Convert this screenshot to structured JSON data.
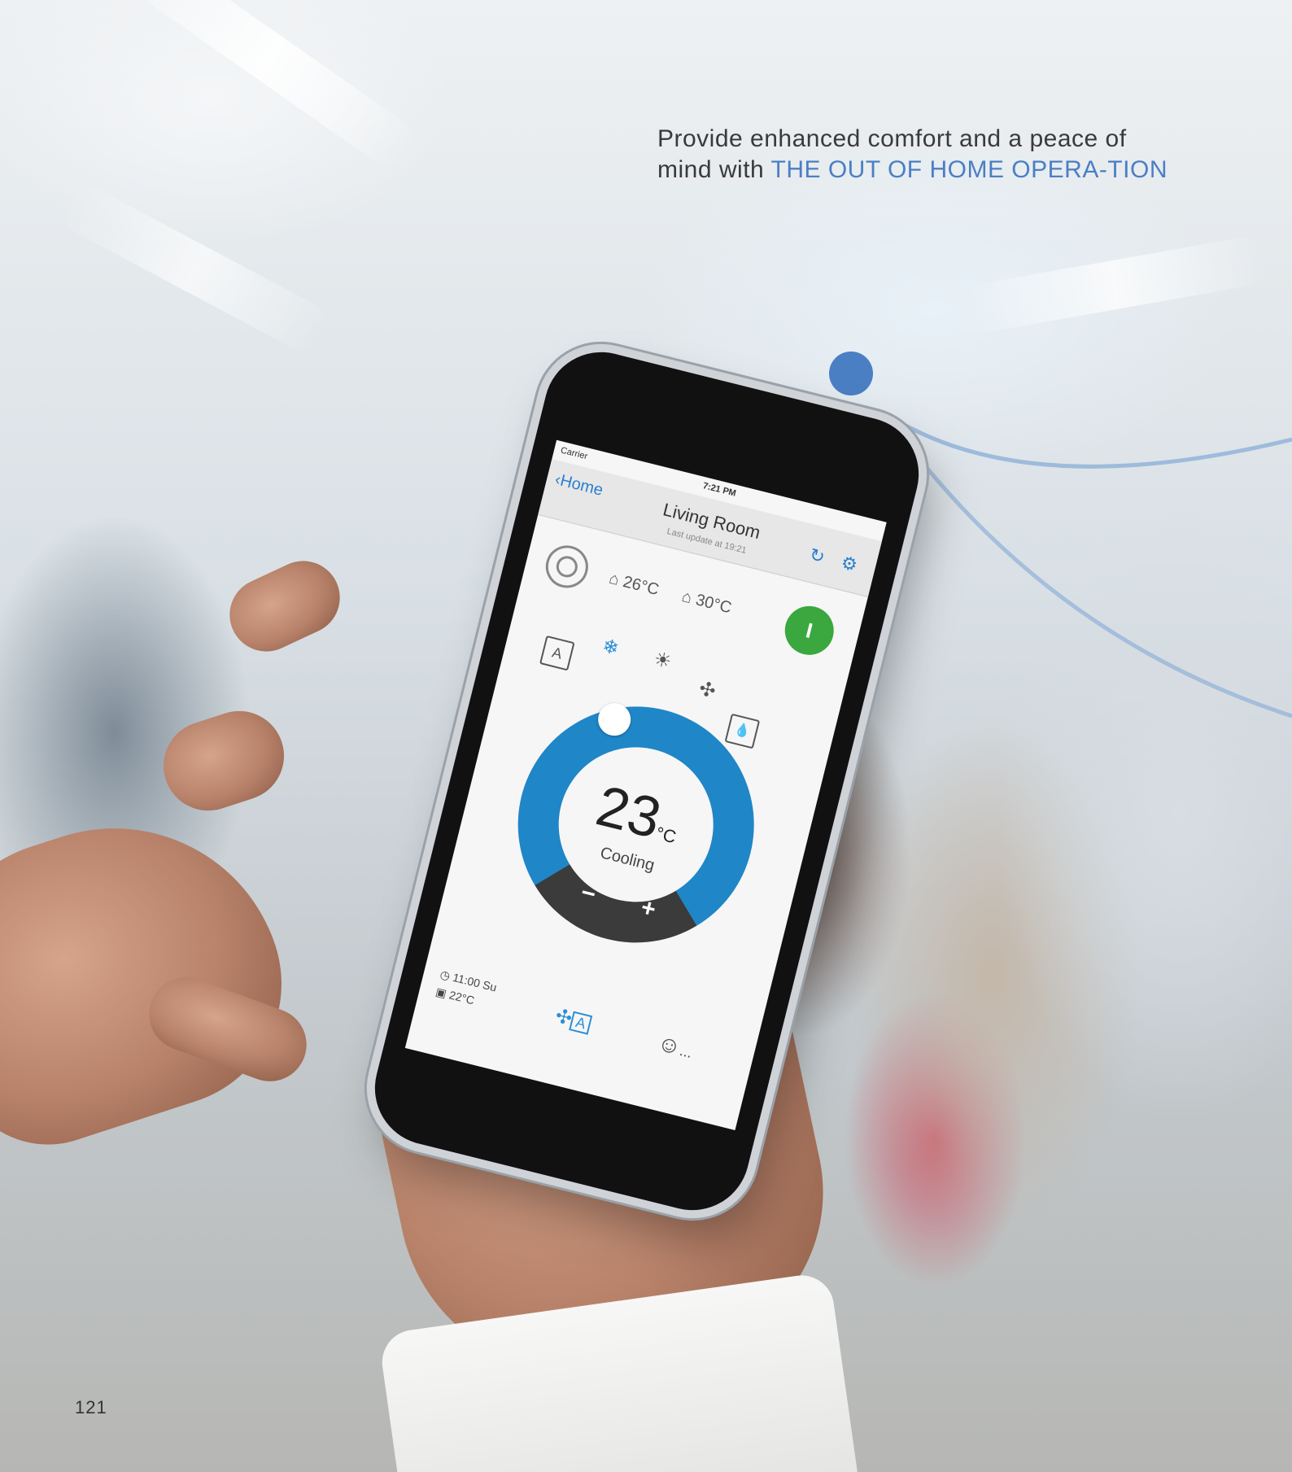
{
  "tagline": {
    "lead": "Provide enhanced comfort and a peace of mind with ",
    "highlight": "THE OUT OF HOME OPERA-TION"
  },
  "page_number": "121",
  "colors": {
    "accent": "#4a7fc4",
    "dial_blue": "#1f86c7",
    "power_green": "#3aa83e"
  },
  "app": {
    "status": {
      "carrier": "Carrier",
      "time": "7:21 PM"
    },
    "nav": {
      "back_label": "Home",
      "title": "Living Room",
      "subtitle": "Last update at 19:21",
      "refresh_icon": "refresh-icon",
      "settings_icon": "gear-icon"
    },
    "indoor_temp": "26°C",
    "outdoor_temp": "30°C",
    "power_label": "I",
    "modes": [
      {
        "name": "auto",
        "label": "A",
        "icon": "auto-mode-icon",
        "active": false
      },
      {
        "name": "cool",
        "label": "❄",
        "icon": "snowflake-icon",
        "active": true
      },
      {
        "name": "heat",
        "label": "☀",
        "icon": "sun-icon",
        "active": false
      },
      {
        "name": "fan",
        "label": "✣",
        "icon": "fan-icon",
        "active": false
      },
      {
        "name": "dry",
        "label": "💧",
        "icon": "droplet-icon",
        "active": false
      }
    ],
    "setpoint": {
      "value": "23",
      "unit": "°C",
      "mode": "Cooling",
      "minus": "−",
      "plus": "+"
    },
    "footer": {
      "timer": "11:00 Su",
      "timer_temp": "22°C",
      "fan_label": "A",
      "more": "..."
    }
  }
}
